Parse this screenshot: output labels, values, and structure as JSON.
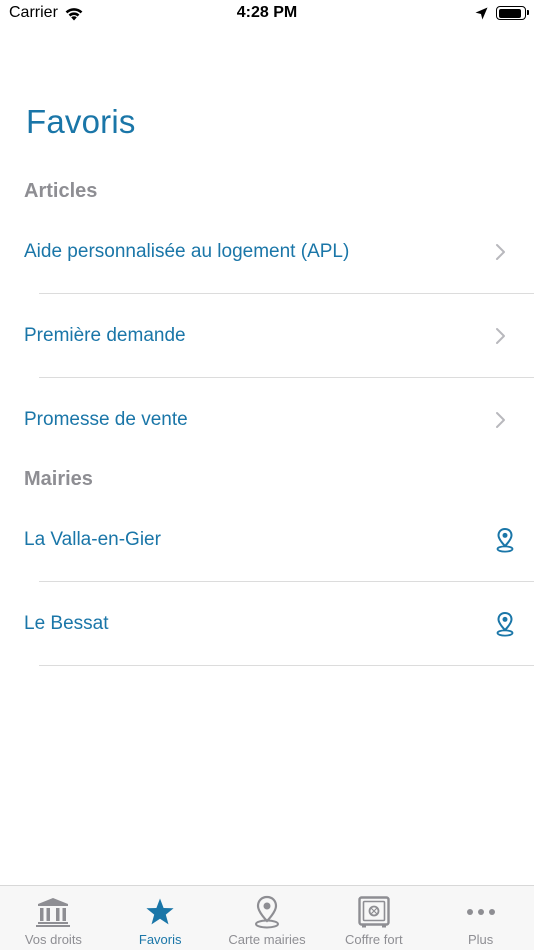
{
  "status_bar": {
    "carrier": "Carrier",
    "time": "4:28 PM",
    "battery_level": 0.9
  },
  "page": {
    "title": "Favoris"
  },
  "sections": [
    {
      "header": "Articles",
      "items": [
        {
          "label": "Aide personnalisée au logement (APL)",
          "accessory": "chevron-right-icon"
        },
        {
          "label": "Première demande",
          "accessory": "chevron-right-icon"
        },
        {
          "label": "Promesse de vente",
          "accessory": "chevron-right-icon"
        }
      ]
    },
    {
      "header": "Mairies",
      "items": [
        {
          "label": "La Valla-en-Gier",
          "accessory": "location-pin-icon"
        },
        {
          "label": "Le Bessat",
          "accessory": "location-pin-icon"
        }
      ]
    }
  ],
  "tab_bar": {
    "active_index": 1,
    "tabs": [
      {
        "label": "Vos droits",
        "icon": "bank-icon"
      },
      {
        "label": "Favoris",
        "icon": "star-icon"
      },
      {
        "label": "Carte mairies",
        "icon": "map-pin-icon"
      },
      {
        "label": "Coffre fort",
        "icon": "safe-icon"
      },
      {
        "label": "Plus",
        "icon": "more-icon"
      }
    ]
  },
  "colors": {
    "accent": "#1a76a8",
    "inactive": "#8e8e93",
    "separator": "#dcdcdc"
  }
}
